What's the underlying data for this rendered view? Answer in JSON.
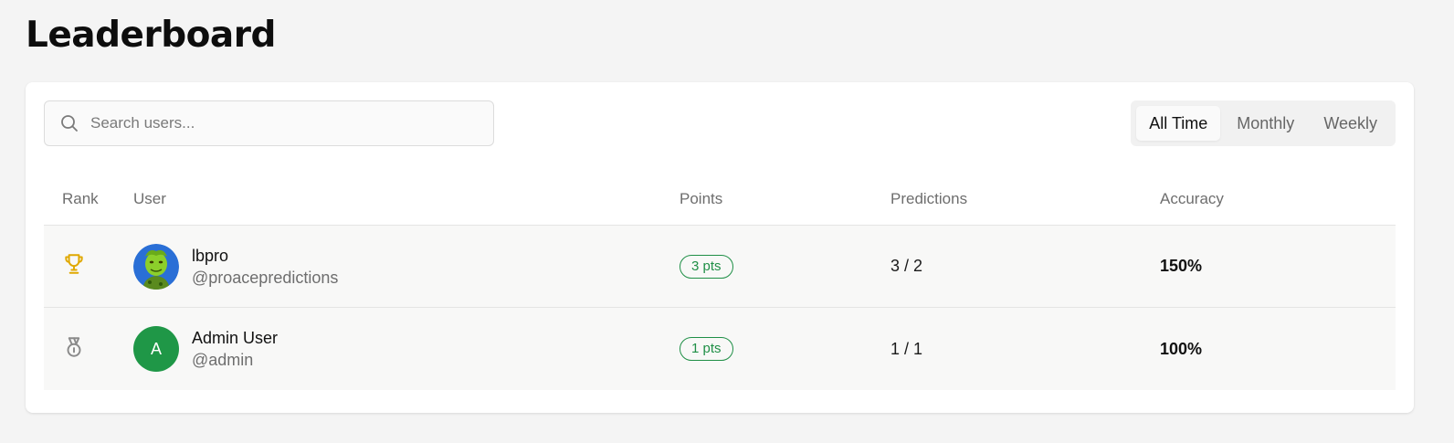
{
  "page": {
    "title": "Leaderboard"
  },
  "search": {
    "placeholder": "Search users...",
    "icon": "search-icon"
  },
  "period_tabs": [
    {
      "label": "All Time",
      "active": true
    },
    {
      "label": "Monthly",
      "active": false
    },
    {
      "label": "Weekly",
      "active": false
    }
  ],
  "table": {
    "headers": {
      "rank": "Rank",
      "user": "User",
      "points": "Points",
      "predictions": "Predictions",
      "accuracy": "Accuracy"
    },
    "rows": [
      {
        "rank_icon": "trophy-icon",
        "rank_color": "#e0a800",
        "avatar": "avatar-image",
        "name": "lbpro",
        "handle": "@proacepredictions",
        "points": "3 pts",
        "predictions": "3 / 2",
        "accuracy": "150%"
      },
      {
        "rank_icon": "medal-icon",
        "rank_color": "#8a8a8a",
        "avatar_letter": "A",
        "avatar_color": "#1f9747",
        "name": "Admin User",
        "handle": "@admin",
        "points": "1 pts",
        "predictions": "1 / 1",
        "accuracy": "100%"
      }
    ]
  },
  "colors": {
    "accent_green": "#1f8f46",
    "background": "#f4f4f4"
  }
}
